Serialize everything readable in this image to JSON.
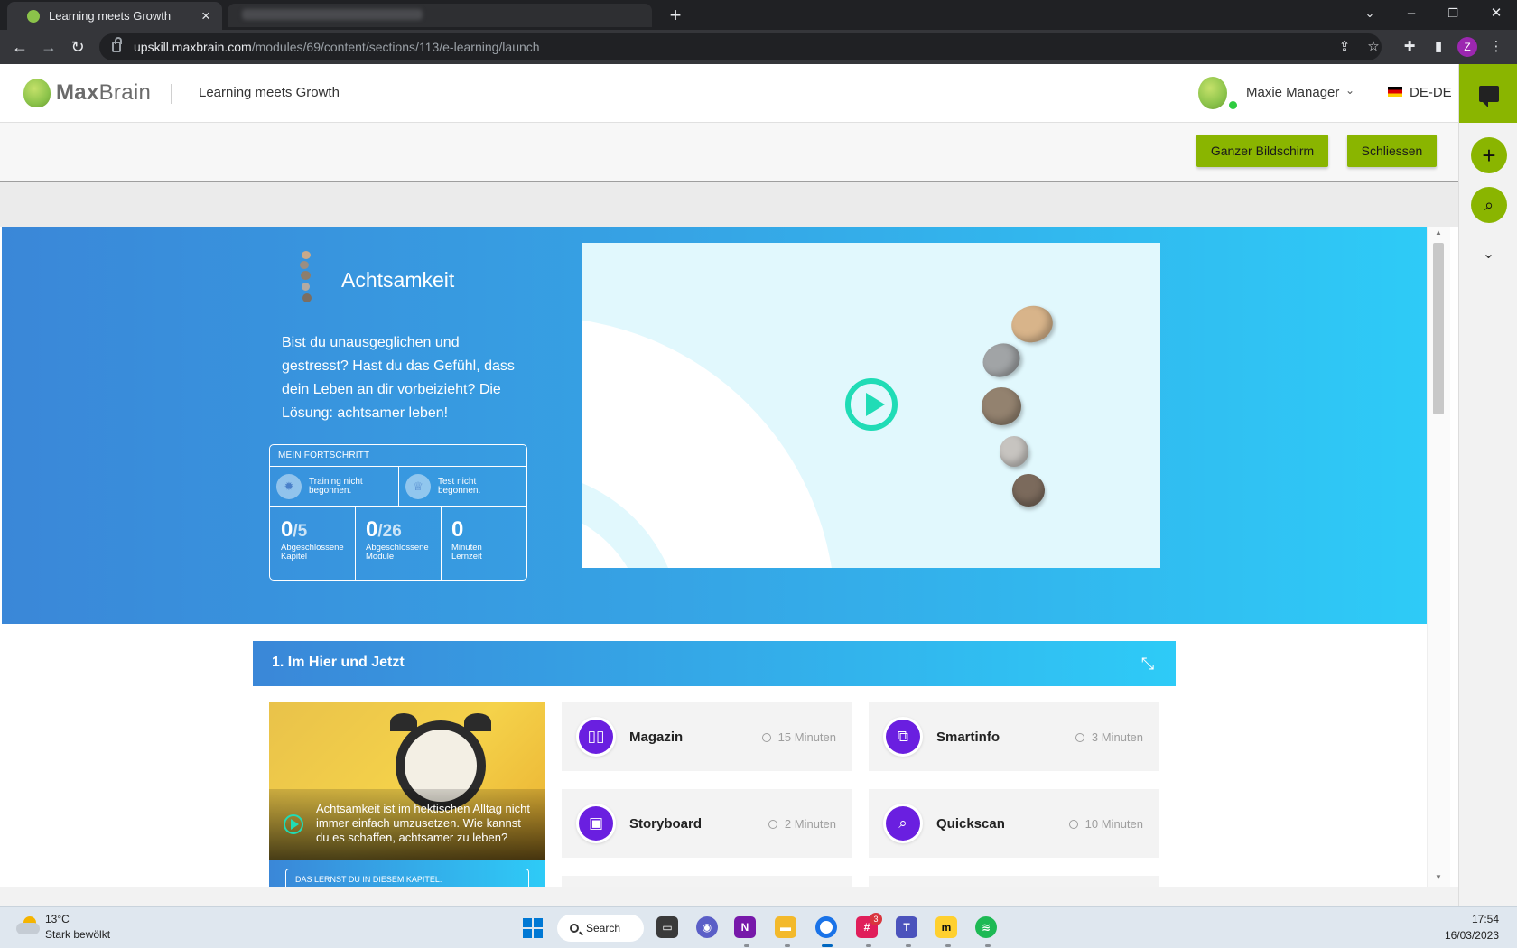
{
  "browser": {
    "tab_title": "Learning meets Growth",
    "url_host": "upskill.maxbrain.com",
    "url_path": "/modules/69/content/sections/113/e-learning/launch",
    "profile_initial": "Z"
  },
  "header": {
    "logo_bold": "Max",
    "logo_thin": "Brain",
    "title": "Learning meets Growth",
    "user_name": "Maxie Manager",
    "language": "DE-DE"
  },
  "actions": {
    "fullscreen": "Ganzer Bildschirm",
    "close": "Schliessen"
  },
  "hero": {
    "title": "Achtsamkeit",
    "description": "Bist du unausgeglichen und gestresst? Hast du das Gefühl, dass dein Leben an dir vorbeizieht? Die Lösung: achtsamer leben!"
  },
  "progress": {
    "header": "MEIN FORTSCHRITT",
    "training_status": "Training nicht begonnen.",
    "test_status": "Test nicht begonnen.",
    "chapters_done": "0",
    "chapters_total": "/5",
    "chapters_label": "Abgeschlossene Kapitel",
    "modules_done": "0",
    "modules_total": "/26",
    "modules_label": "Abgeschlossene Module",
    "minutes": "0",
    "minutes_label": "Minuten Lernzeit"
  },
  "chapter": {
    "title": "1. Im Hier und Jetzt",
    "teaser_text": "Achtsamkeit ist im hektischen Alltag nicht immer einfach umzusetzen. Wie kannst du es schaffen, achtsamer zu leben?",
    "learn_box": "DAS LERNST DU IN DIESEM KAPITEL:",
    "modules": [
      {
        "name": "Magazin",
        "time": "15 Minuten",
        "icon": "book-icon"
      },
      {
        "name": "Smartinfo",
        "time": "3 Minuten",
        "icon": "flowchart-icon"
      },
      {
        "name": "Storyboard",
        "time": "2 Minuten",
        "icon": "image-icon"
      },
      {
        "name": "Quickscan",
        "time": "10 Minuten",
        "icon": "magnifier-icon"
      }
    ]
  },
  "taskbar": {
    "temperature": "13°C",
    "weather": "Stark bewölkt",
    "search": "Search",
    "slack_badge": "3",
    "time": "17:54",
    "date": "16/03/2023"
  },
  "colors": {
    "accent_green": "#8ab500",
    "hero_start": "#3a87d8",
    "hero_end": "#2ecbf7",
    "module_purple": "#6a1fe0",
    "play_teal": "#20dcb6"
  }
}
